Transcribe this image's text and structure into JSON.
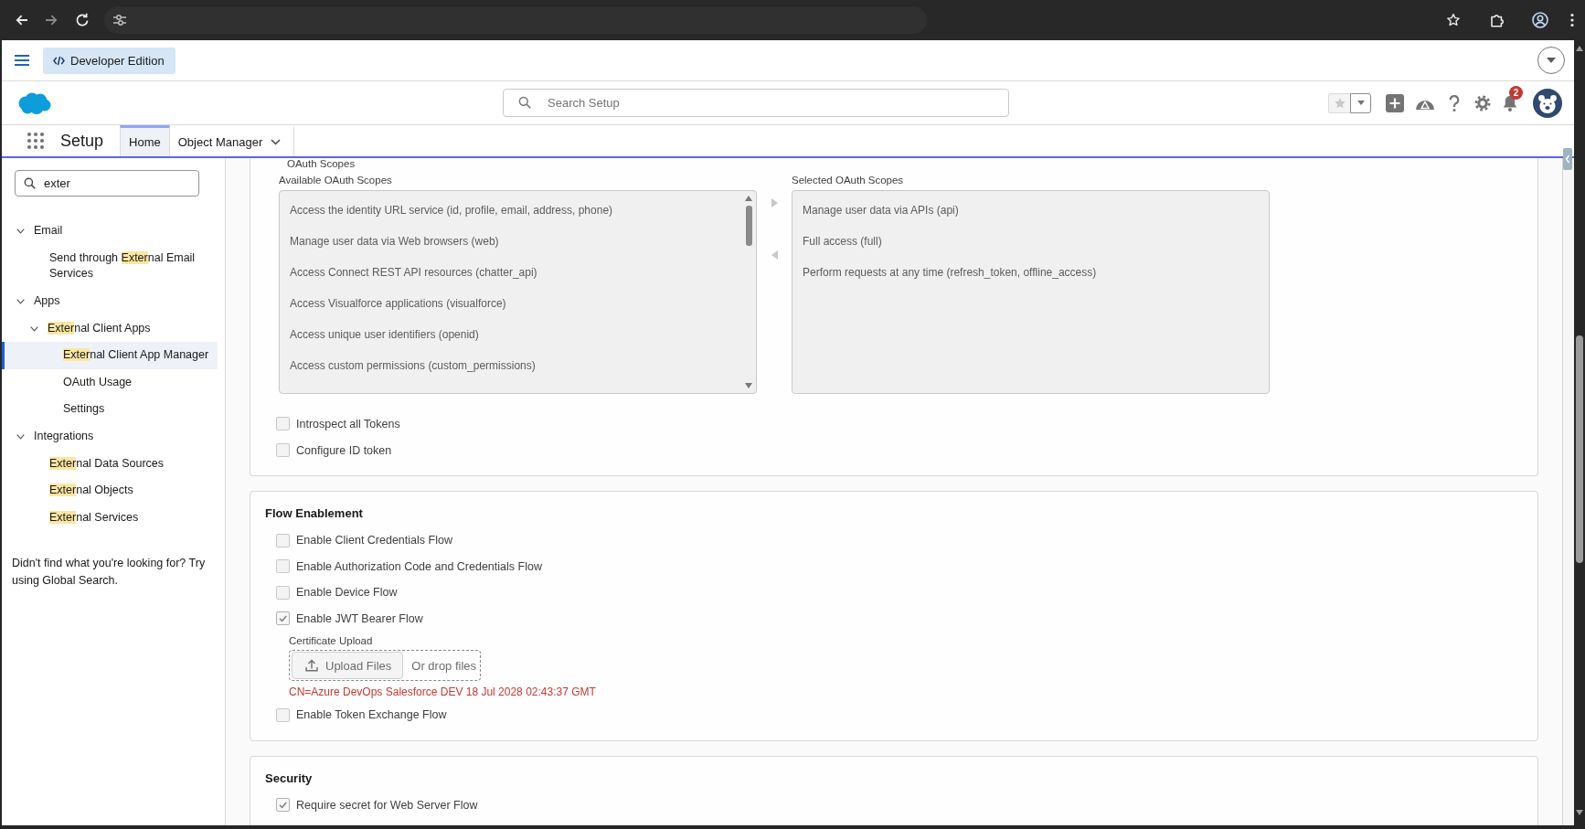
{
  "header": {
    "edition": "Developer Edition",
    "search": {
      "placeholder": "Search Setup"
    },
    "notification_count": "2"
  },
  "nav": {
    "app_name": "Setup",
    "tabs": [
      {
        "label": "Home",
        "kind": "plain",
        "selected": true
      },
      {
        "label": "Object Manager",
        "kind": "menu",
        "selected": false
      }
    ]
  },
  "sidebar": {
    "quick_find": {
      "value": "exter"
    },
    "tree": [
      {
        "label": "Email",
        "expanded": true,
        "selected": false,
        "children": [
          {
            "prefix": "Send through ",
            "match": "Exter",
            "suffix": "nal Email Services",
            "selected": false
          }
        ]
      },
      {
        "label": "Apps",
        "expanded": true,
        "selected": false,
        "children": [
          {
            "match": "Exter",
            "suffix": "nal Client Apps",
            "expanded": true,
            "selected": false,
            "children": [
              {
                "match": "Exter",
                "suffix": "nal Client App Manager",
                "selected": true
              },
              {
                "label": "OAuth Usage",
                "selected": false
              },
              {
                "label": "Settings",
                "selected": false
              }
            ]
          }
        ]
      },
      {
        "label": "Integrations",
        "expanded": true,
        "selected": false,
        "children": [
          {
            "match": "Exter",
            "suffix": "nal Data Sources",
            "selected": false
          },
          {
            "match": "Exter",
            "suffix": "nal Objects",
            "selected": false
          },
          {
            "match": "Exter",
            "suffix": "nal Services",
            "selected": false
          }
        ]
      }
    ],
    "hint": "Didn't find what you're looking for? Try using Global Search."
  },
  "oauth_scopes": {
    "label": "OAuth Scopes",
    "available": {
      "label": "Available OAuth Scopes",
      "items": [
        "Access the identity URL service (id, profile, email, address, phone)",
        "Manage user data via Web browsers (web)",
        "Access Connect REST API resources (chatter_api)",
        "Access Visualforce applications (visualforce)",
        "Access unique user identifiers (openid)",
        "Access custom permissions (custom_permissions)"
      ]
    },
    "selected": {
      "label": "Selected OAuth Scopes",
      "items": [
        "Manage user data via APIs (api)",
        "Full access (full)",
        "Perform requests at any time (refresh_token, offline_access)"
      ]
    },
    "options": [
      {
        "label": "Introspect all Tokens",
        "checked": false
      },
      {
        "label": "Configure ID token",
        "checked": false
      }
    ]
  },
  "flow_enablement": {
    "title": "Flow Enablement",
    "options": [
      {
        "label": "Enable Client Credentials Flow",
        "checked": false
      },
      {
        "label": "Enable Authorization Code and Credentials Flow",
        "checked": false
      },
      {
        "label": "Enable Device Flow",
        "checked": false
      },
      {
        "label": "Enable JWT Bearer Flow",
        "checked": true,
        "certificate": {
          "label": "Certificate Upload",
          "button": "Upload Files",
          "drop_hint": "Or drop files",
          "file": "CN=Azure DevOps Salesforce DEV 18 Jul 2028 02:43:37 GMT"
        }
      },
      {
        "label": "Enable Token Exchange Flow",
        "checked": false
      }
    ]
  },
  "security": {
    "title": "Security",
    "options": [
      {
        "label": "Require secret for Web Server Flow",
        "checked": true
      }
    ]
  }
}
